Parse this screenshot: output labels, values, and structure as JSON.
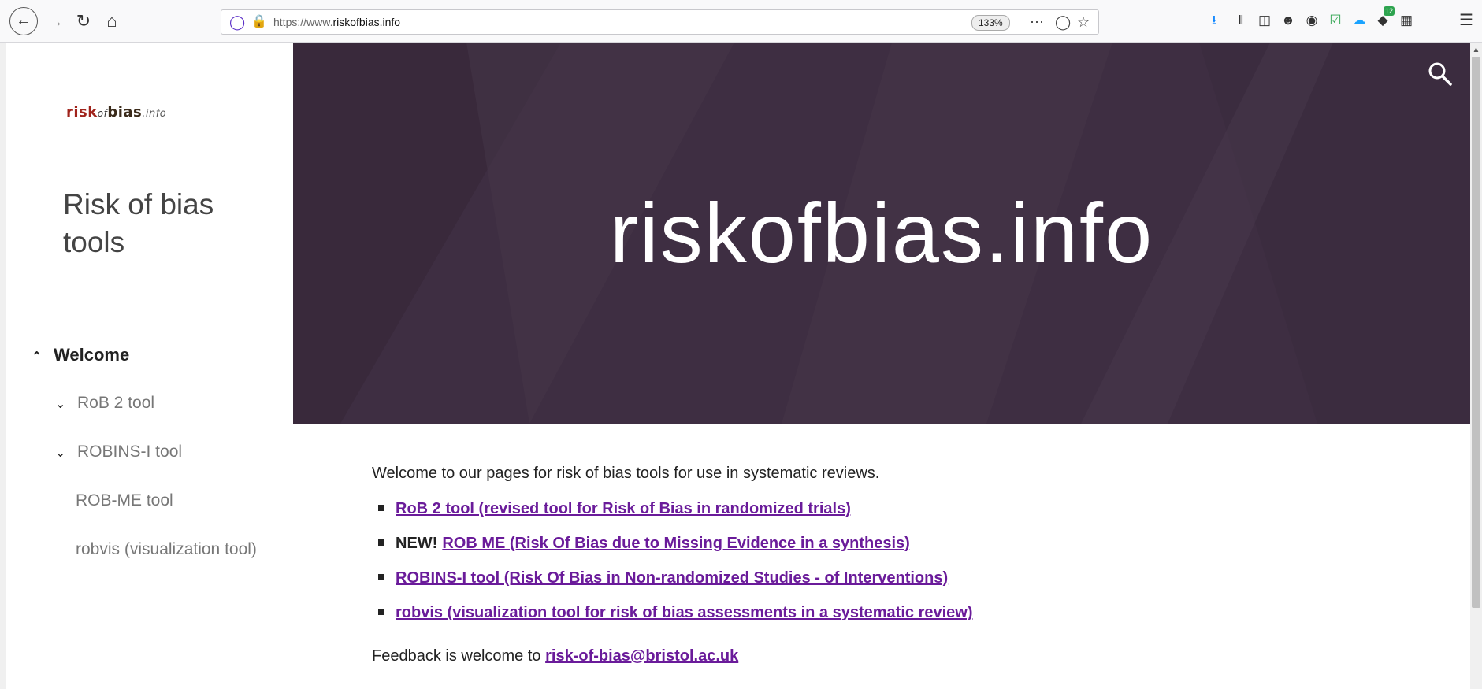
{
  "browser": {
    "url_prefix": "https://www.",
    "url_domain": "riskofbias.info",
    "zoom": "133%",
    "badge_count": "12"
  },
  "sidebar": {
    "logo": {
      "part1": "risk",
      "part2": "of",
      "part3": "bias",
      "part4": ".info"
    },
    "site_title": "Risk of bias tools",
    "nav": [
      {
        "label": "Welcome",
        "expanded": true,
        "active": true
      },
      {
        "label": "RoB 2 tool",
        "expandable": true
      },
      {
        "label": "ROBINS-I tool",
        "expandable": true
      },
      {
        "label": "ROB-ME tool"
      },
      {
        "label": "robvis (visualization tool)"
      }
    ]
  },
  "hero": {
    "title": "riskofbias.info",
    "background": "#3e2e42"
  },
  "main": {
    "intro": "Welcome to our pages for risk of bias tools for use in systematic reviews.",
    "links": [
      {
        "prefix": "",
        "text": "RoB 2 tool (revised tool for Risk of Bias in randomized trials)"
      },
      {
        "prefix": "NEW!",
        "text": "ROB ME (Risk Of Bias due to Missing Evidence in a synthesis)"
      },
      {
        "prefix": "",
        "text": "ROBINS-I tool (Risk Of Bias in Non-randomized Studies - of Interventions)"
      },
      {
        "prefix": "",
        "text": "robvis (visualization tool for risk of bias assessments in a systematic review)"
      }
    ],
    "feedback_prefix": "Feedback is welcome to",
    "feedback_email": "risk-of-bias@bristol.ac.uk",
    "link_color": "#6a1b9a"
  }
}
